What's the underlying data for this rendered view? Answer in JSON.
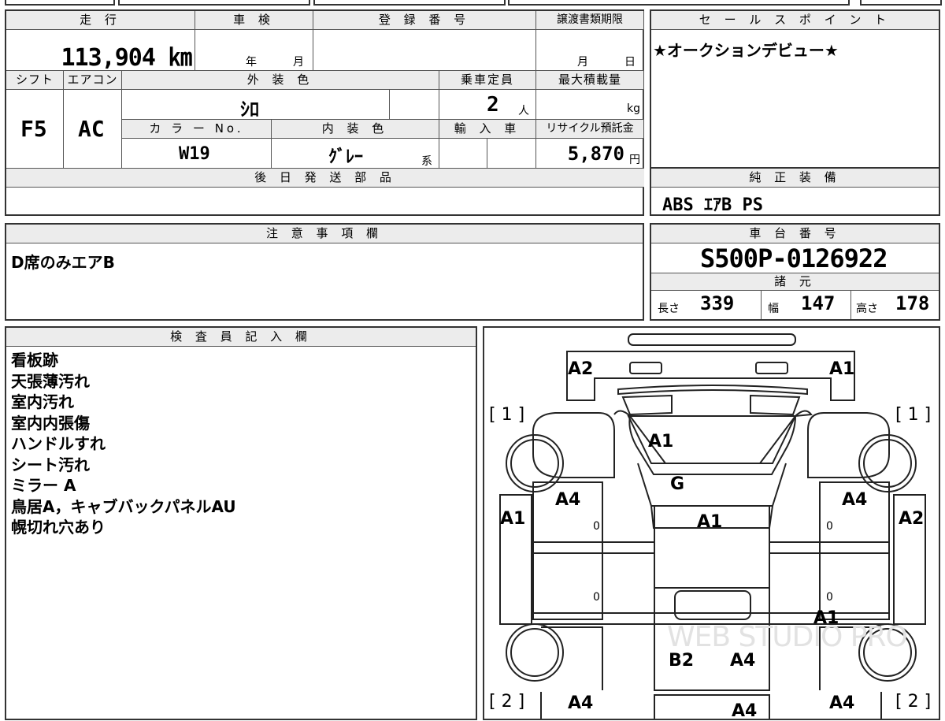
{
  "table": {
    "mileage_label": "走 行",
    "mileage_value": "113,904 ㎞",
    "shaken_label": "車 検",
    "shaken_year": "年",
    "shaken_month": "月",
    "reg_label": "登 録 番 号",
    "transfer_label": "譲渡書類期限",
    "transfer_month": "月",
    "transfer_day": "日",
    "shift_label": "シフト",
    "shift_value": "F5",
    "ac_label": "エアコン",
    "ac_value": "AC",
    "ext_color_label": "外 装 色",
    "ext_color_value": "ｼﾛ",
    "capacity_label": "乗車定員",
    "capacity_value": "2",
    "capacity_unit": "人",
    "max_load_label": "最大積載量",
    "max_load_unit": "kg",
    "color_no_label": "カ ラ ー No.",
    "color_no_value": "W19",
    "int_color_label": "内 装 色",
    "int_color_value": "ｸﾞﾚｰ",
    "int_color_suffix": "系",
    "import_label": "輸 入 車",
    "recycle_label": "リサイクル預託金",
    "recycle_value": "5,870",
    "recycle_unit": "円",
    "later_parts_label": "後 日 発 送 部 品"
  },
  "sales": {
    "label": "セ ー ル ス ポ イ ン ト",
    "value": "★オークションデビュー★"
  },
  "equipment": {
    "label": "純 正 装 備",
    "value": "ABS ｴｱB PS"
  },
  "notice": {
    "label": "注 意 事 項 欄",
    "value": "D席のみエアB"
  },
  "chassis": {
    "label": "車 台 番 号",
    "value": "S500P-0126922",
    "specs_label": "諸 元",
    "length_label": "長さ",
    "length_value": "339",
    "width_label": "幅",
    "width_value": "147",
    "height_label": "高さ",
    "height_value": "178"
  },
  "inspector": {
    "label": "検 査 員 記 入 欄",
    "lines": [
      "看板跡",
      "天張薄汚れ",
      "室内汚れ",
      "室内内張傷",
      "ハンドルすれ",
      "シート汚れ",
      "ミラー A",
      "鳥居A，キャブバックパネルAU",
      "幌切れ穴あり"
    ]
  },
  "diagram": {
    "bracket_1_left": "[ 1 ]",
    "bracket_1_right": "[ 1 ]",
    "bracket_2_left": "[ 2 ]",
    "bracket_2_right": "[ 2 ]",
    "marks": {
      "a2_top_left": "A2",
      "a1_top_right": "A1",
      "a1_windshield": "A1",
      "g_wiper": "G",
      "a1_roof": "A1",
      "a4_left_front": "A4",
      "a4_right_front": "A4",
      "a1_left_side": "A1",
      "a2_right_side": "A2",
      "a1_right_lower": "A1",
      "b2_bed": "B2",
      "a4_bed": "A4",
      "a4_left_rear": "A4",
      "a4_center_rear": "A4",
      "a4_right_rear": "A4",
      "zero_1": "0",
      "zero_2": "0",
      "zero_3": "0",
      "zero_4": "0"
    },
    "watermark": "WEB STUDIO PRO"
  }
}
